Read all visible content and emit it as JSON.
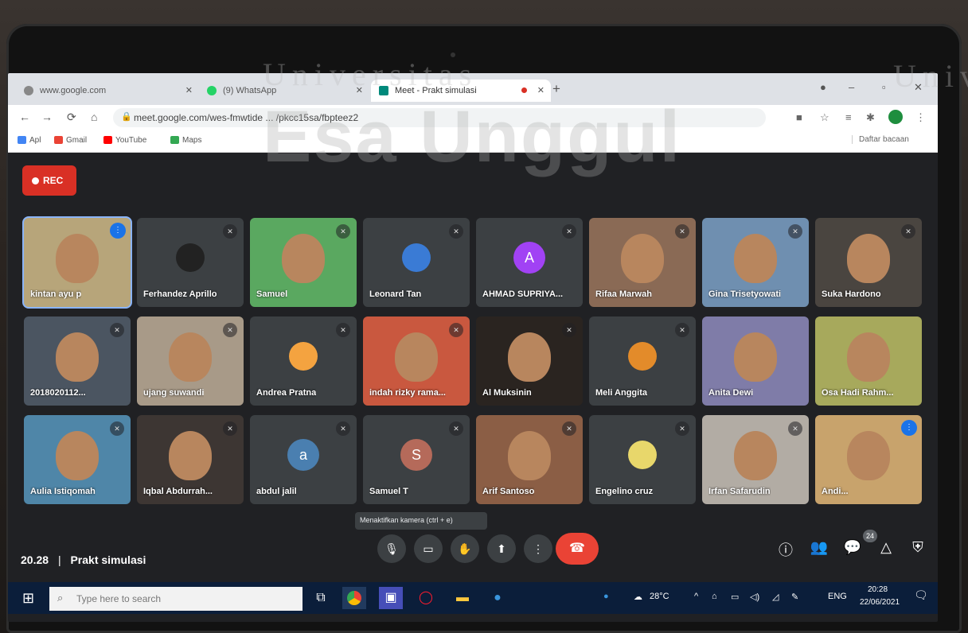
{
  "watermark": {
    "top_text": "Universitas",
    "main_text": "Esa Unggul",
    "right_text": "Univ"
  },
  "browser": {
    "tabs": [
      {
        "title": "www.google.com",
        "favicon_color": "#888888"
      },
      {
        "title": "(9) WhatsApp",
        "favicon_color": "#25D366"
      },
      {
        "title": "Meet - Prakt simulasi",
        "favicon_color": "#00897B"
      }
    ],
    "url": "meet.google.com/wes-fmwtide ... /pkcc15sa/fbpteez2",
    "bookmarks": [
      {
        "label": "Apl",
        "icon_color": "#4285F4"
      },
      {
        "label": "Gmail",
        "icon_color": "#EA4335"
      },
      {
        "label": "YouTube",
        "icon_color": "#FF0000"
      },
      {
        "label": "Maps",
        "icon_color": "#34A853"
      }
    ],
    "reading_list": "Daftar bacaan"
  },
  "meet": {
    "rec_label": "REC",
    "participants": [
      {
        "name": "kintan ayu p",
        "kind": "video",
        "bg": "#b7a57a",
        "mic": "speaking",
        "active": true
      },
      {
        "name": "Ferhandez Aprillo",
        "kind": "photo",
        "bg": "#3c4043",
        "photo_color": "#222222",
        "mic": "muted"
      },
      {
        "name": "Samuel",
        "kind": "video",
        "bg": "#5aa860",
        "mic": "muted"
      },
      {
        "name": "Leonard Tan",
        "kind": "photo",
        "bg": "#3c4043",
        "photo_color": "#3a7bd5",
        "mic": "muted"
      },
      {
        "name": "AHMAD SUPRIYA...",
        "kind": "letter",
        "letter": "A",
        "bg": "#3c4043",
        "avatar_color": "#a142f4",
        "mic": "muted"
      },
      {
        "name": "Rifaa Marwah",
        "kind": "video",
        "bg": "#8a6a55",
        "mic": "muted"
      },
      {
        "name": "Gina Trisetyowati",
        "kind": "video",
        "bg": "#6f8fb0",
        "mic": "muted"
      },
      {
        "name": "Suka Hardono",
        "kind": "video",
        "bg": "#4a4540",
        "mic": "muted"
      },
      {
        "name": "2018020112...",
        "kind": "video",
        "bg": "#4b5561",
        "mic": "muted"
      },
      {
        "name": "ujang suwandi",
        "kind": "video",
        "bg": "#a89a88",
        "mic": "muted"
      },
      {
        "name": "Andrea Pratna",
        "kind": "photo",
        "bg": "#3c4043",
        "photo_color": "#f4a340",
        "mic": "muted"
      },
      {
        "name": "indah rizky rama...",
        "kind": "video",
        "bg": "#c9583f",
        "mic": "muted"
      },
      {
        "name": "Al Muksinin",
        "kind": "video",
        "bg": "#2a2420",
        "mic": "muted"
      },
      {
        "name": "Meli Anggita",
        "kind": "photo",
        "bg": "#3c4043",
        "photo_color": "#e38b2a",
        "mic": "muted"
      },
      {
        "name": "Anita Dewi",
        "kind": "video",
        "bg": "#7f7ca8",
        "mic": "none"
      },
      {
        "name": "Osa Hadi Rahm...",
        "kind": "video",
        "bg": "#a7a95c",
        "mic": "none"
      },
      {
        "name": "Aulia Istiqomah",
        "kind": "video",
        "bg": "#4f86a8",
        "mic": "muted"
      },
      {
        "name": "Iqbal Abdurrah...",
        "kind": "video",
        "bg": "#3d3633",
        "mic": "muted"
      },
      {
        "name": "abdul jalil",
        "kind": "letter",
        "letter": "a",
        "bg": "#3c4043",
        "avatar_color": "#4a7fb0",
        "mic": "muted"
      },
      {
        "name": "Samuel T",
        "kind": "letter",
        "letter": "S",
        "bg": "#3c4043",
        "avatar_color": "#b56a5a",
        "mic": "muted"
      },
      {
        "name": "Arif Santoso",
        "kind": "video",
        "bg": "#8b5e45",
        "mic": "muted"
      },
      {
        "name": "Engelino cruz",
        "kind": "photo",
        "bg": "#3c4043",
        "photo_color": "#e8d76b",
        "mic": "muted"
      },
      {
        "name": "Irfan Safarudin",
        "kind": "video",
        "bg": "#b2aca4",
        "mic": "muted"
      },
      {
        "name": "Andi...",
        "kind": "video",
        "bg": "#c8a36c",
        "mic": "speaking"
      }
    ],
    "meeting_time": "20.28",
    "meeting_name": "Prakt simulasi",
    "tooltip": "Menaktifkan kamera (ctrl + e)",
    "people_count": "24"
  },
  "taskbar": {
    "search_placeholder": "Type here to search",
    "weather": "28°C",
    "language": "ENG",
    "time": "20:28",
    "date": "22/06/2021"
  }
}
